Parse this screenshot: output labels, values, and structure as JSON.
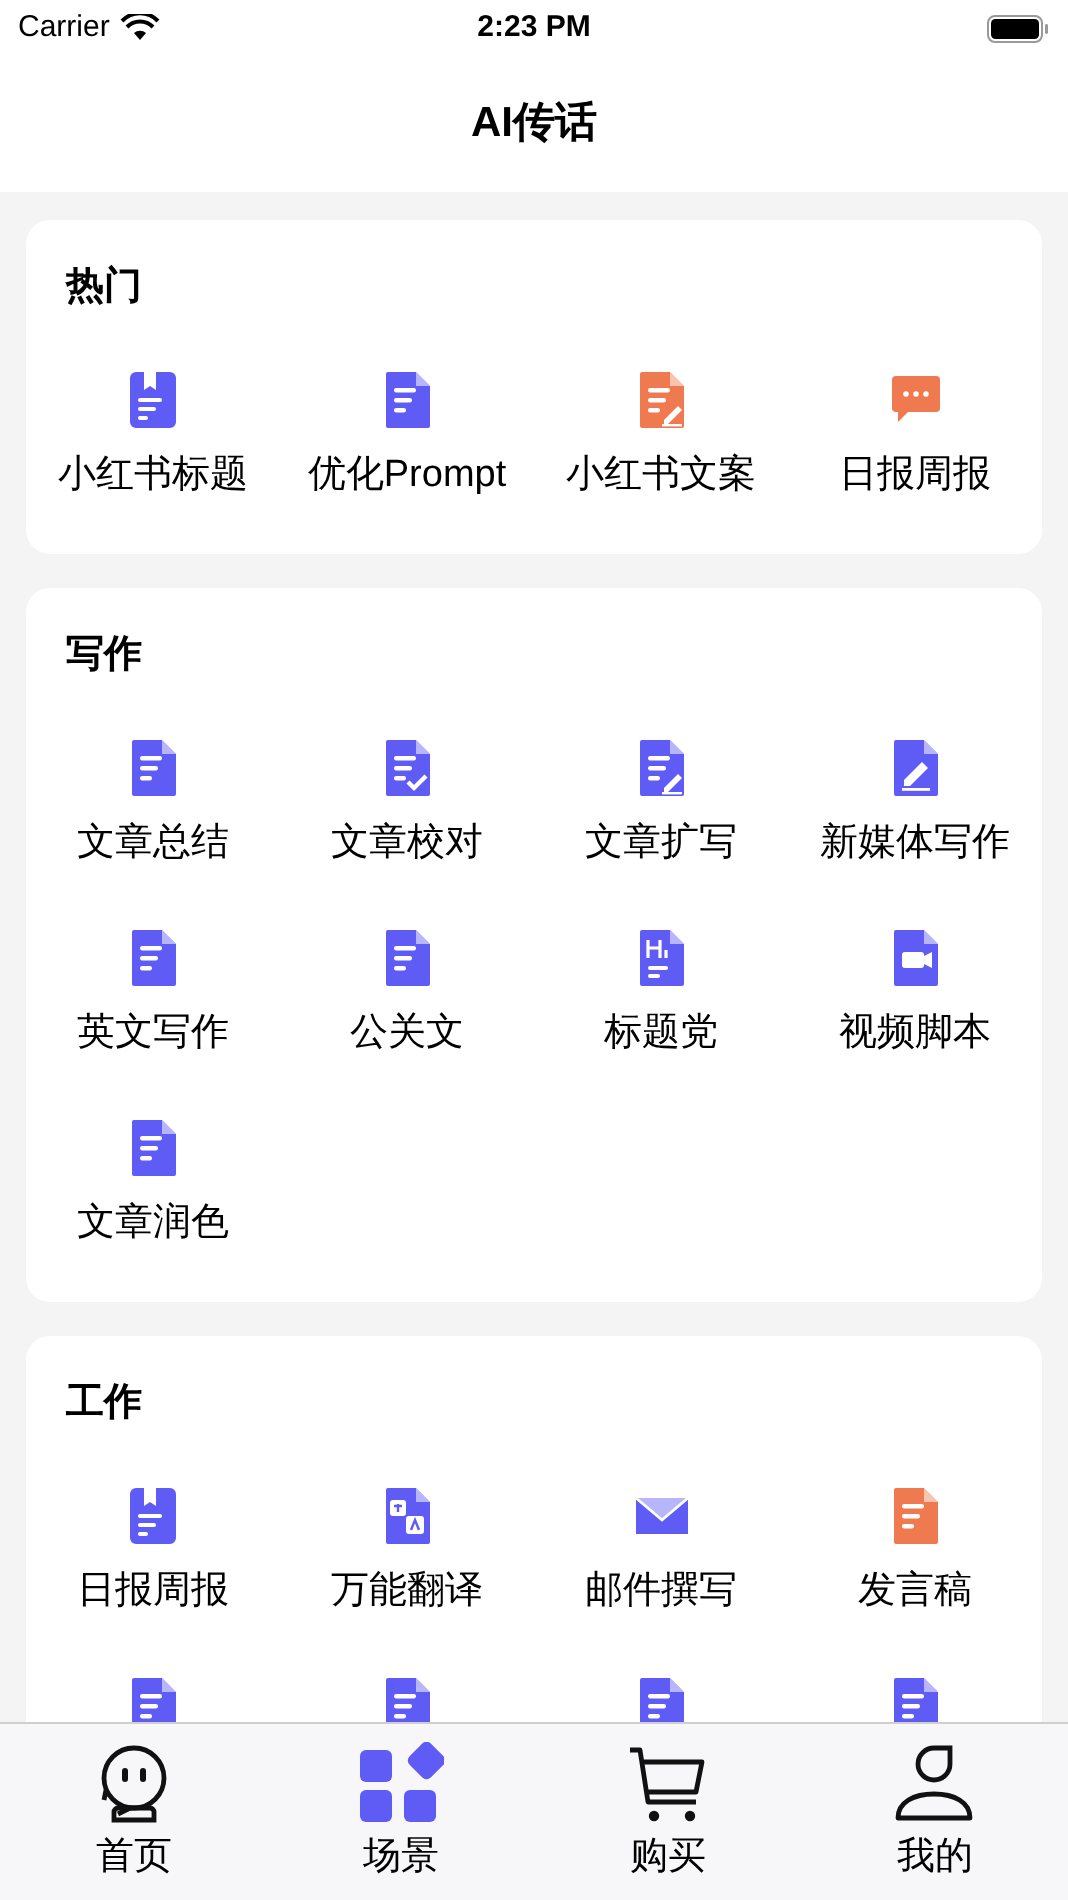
{
  "status_bar": {
    "carrier": "Carrier",
    "time": "2:23 PM"
  },
  "nav": {
    "title": "AI传话"
  },
  "sections": [
    {
      "title": "热门",
      "items": [
        {
          "label": "小红书标题",
          "kind": "bookmark",
          "color": "#5f5cf6"
        },
        {
          "label": "优化Prompt",
          "kind": "doc",
          "color": "#5f5cf6"
        },
        {
          "label": "小红书文案",
          "kind": "edit",
          "color": "#ef7a50"
        },
        {
          "label": "日报周报",
          "kind": "chat",
          "color": "#ef7a50"
        }
      ]
    },
    {
      "title": "写作",
      "items": [
        {
          "label": "文章总结",
          "kind": "doc",
          "color": "#5f5cf6"
        },
        {
          "label": "文章校对",
          "kind": "check",
          "color": "#5f5cf6"
        },
        {
          "label": "文章扩写",
          "kind": "edit",
          "color": "#5f5cf6"
        },
        {
          "label": "新媒体写作",
          "kind": "pen",
          "color": "#5f5cf6"
        },
        {
          "label": "英文写作",
          "kind": "doc",
          "color": "#5f5cf6"
        },
        {
          "label": "公关文",
          "kind": "doc",
          "color": "#5f5cf6"
        },
        {
          "label": "标题党",
          "kind": "heading",
          "color": "#5f5cf6"
        },
        {
          "label": "视频脚本",
          "kind": "video",
          "color": "#5f5cf6"
        },
        {
          "label": "文章润色",
          "kind": "doc",
          "color": "#5f5cf6"
        }
      ]
    },
    {
      "title": "工作",
      "items": [
        {
          "label": "日报周报",
          "kind": "bookmark",
          "color": "#5f5cf6"
        },
        {
          "label": "万能翻译",
          "kind": "translate",
          "color": "#5f5cf6"
        },
        {
          "label": "邮件撰写",
          "kind": "mail",
          "color": "#5f5cf6"
        },
        {
          "label": "发言稿",
          "kind": "doc",
          "color": "#ef7a50"
        },
        {
          "kind": "doc",
          "color": "#5f5cf6"
        },
        {
          "kind": "doc",
          "color": "#5f5cf6"
        },
        {
          "kind": "doc",
          "color": "#5f5cf6"
        },
        {
          "kind": "doc",
          "color": "#5f5cf6"
        }
      ]
    }
  ],
  "tabs": [
    {
      "label": "首页",
      "kind": "robot",
      "selected": false
    },
    {
      "label": "场景",
      "kind": "grid",
      "selected": true
    },
    {
      "label": "购买",
      "kind": "cart",
      "selected": false
    },
    {
      "label": "我的",
      "kind": "person",
      "selected": false
    }
  ]
}
